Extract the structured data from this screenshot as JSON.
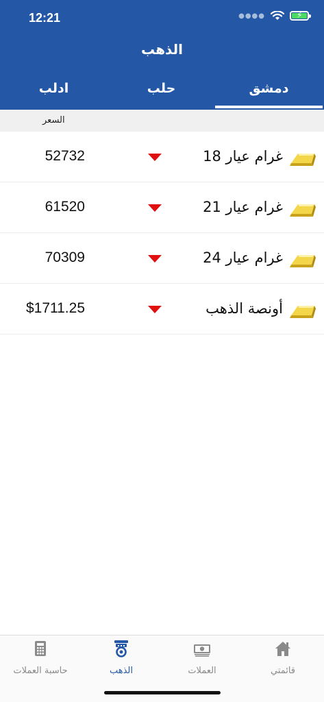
{
  "status": {
    "time": "12:21"
  },
  "header": {
    "title": "الذهب"
  },
  "tabs": [
    {
      "label": "ادلب",
      "active": false
    },
    {
      "label": "حلب",
      "active": false
    },
    {
      "label": "دمشق",
      "active": true
    }
  ],
  "list": {
    "column_header": "السعر",
    "rows": [
      {
        "name": "غرام عيار 18",
        "price": "52732",
        "trend": "down"
      },
      {
        "name": "غرام عيار 21",
        "price": "61520",
        "trend": "down"
      },
      {
        "name": "غرام عيار 24",
        "price": "70309",
        "trend": "down"
      },
      {
        "name": "أونصة الذهب",
        "price": "$1711.25",
        "trend": "down"
      }
    ]
  },
  "tabbar": {
    "items": [
      {
        "label": "حاسبة العملات",
        "icon": "calculator-icon",
        "active": false
      },
      {
        "label": "الذهب",
        "icon": "gold-medal-icon",
        "active": true
      },
      {
        "label": "العملات",
        "icon": "banknote-icon",
        "active": false
      },
      {
        "label": "قائمتي",
        "icon": "home-icon",
        "active": false
      }
    ]
  },
  "colors": {
    "primary": "#2458a6",
    "trend_down": "#e01010",
    "gold": "#e8c53a"
  }
}
